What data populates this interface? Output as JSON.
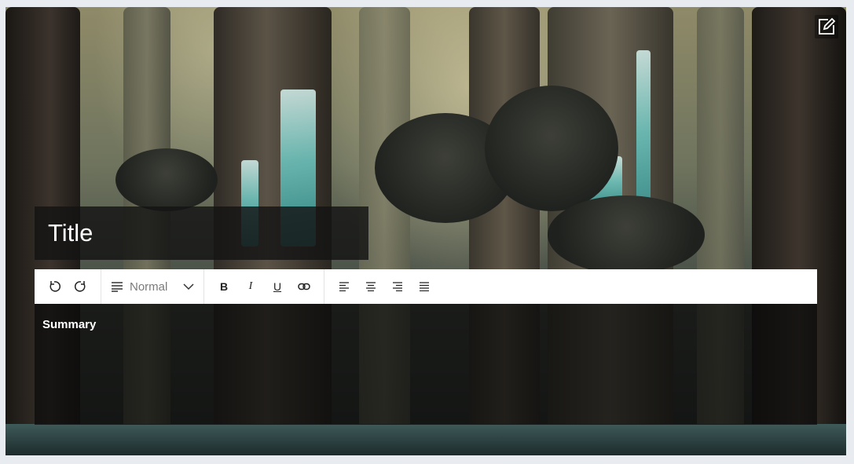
{
  "editor": {
    "title_placeholder": "Title",
    "summary_placeholder": "Summary"
  },
  "toolbar": {
    "undo_icon": "undo-icon",
    "redo_icon": "redo-icon",
    "format_value": "Normal",
    "bold_label": "B",
    "italic_label": "I",
    "underline_label": "U",
    "link_icon": "link-icon",
    "align_left_icon": "align-left-icon",
    "align_center_icon": "align-center-icon",
    "align_right_icon": "align-right-icon",
    "align_justify_icon": "align-justify-icon"
  },
  "edit_icon": "edit-icon"
}
